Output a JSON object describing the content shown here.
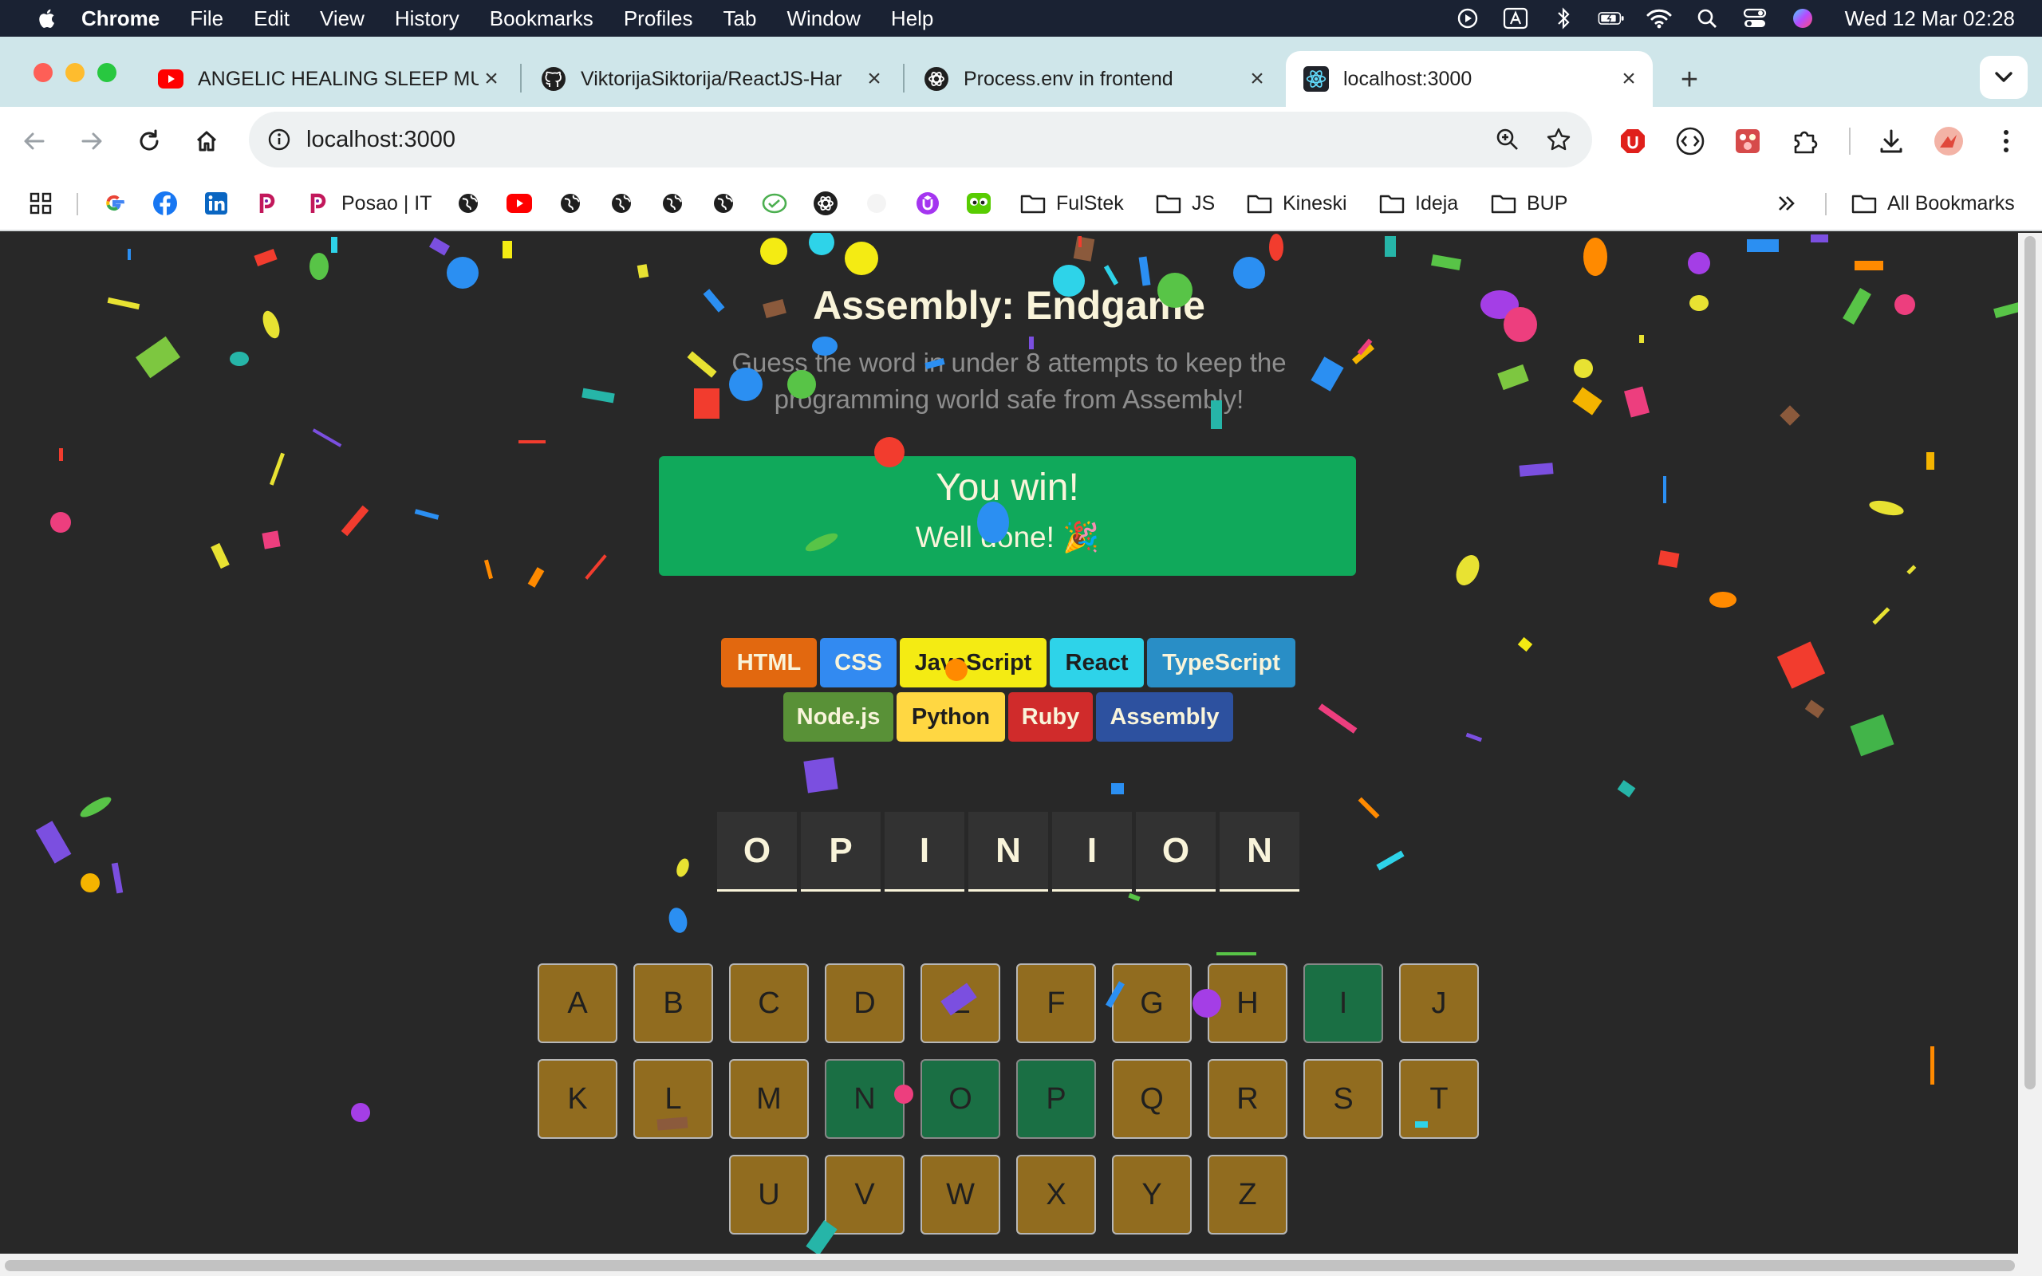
{
  "menubar": {
    "app_name": "Chrome",
    "items": [
      "File",
      "Edit",
      "View",
      "History",
      "Bookmarks",
      "Profiles",
      "Tab",
      "Window",
      "Help"
    ],
    "clock": "Wed 12 Mar  02:28"
  },
  "tabs": [
    {
      "title": "ANGELIC HEALING SLEEP MU",
      "icon": "youtube-icon"
    },
    {
      "title": "ViktorijaSiktorija/ReactJS-Har",
      "icon": "github-icon"
    },
    {
      "title": "Process.env in frontend",
      "icon": "chatgpt-icon"
    },
    {
      "title": "localhost:3000",
      "icon": "react-icon",
      "active": true
    }
  ],
  "omnibox": {
    "url": "localhost:3000"
  },
  "bookmarks": {
    "posao": "Posao | IT",
    "folders": [
      "FulStek",
      "JS",
      "Kineski",
      "Ideja",
      "BUP"
    ],
    "all": "All Bookmarks"
  },
  "game": {
    "title": "Assembly: Endgame",
    "subtitle": "Guess the word in under 8 attempts to keep the programming world safe from Assembly!",
    "status_title": "You win!",
    "status_sub": "Well done! 🎉",
    "languages": [
      {
        "name": "HTML",
        "bg": "#E2680F",
        "color": "#F9F4DA"
      },
      {
        "name": "CSS",
        "bg": "#328AF1",
        "color": "#F9F4DA"
      },
      {
        "name": "JavaScript",
        "bg": "#F4EB13",
        "color": "#1E1E1E"
      },
      {
        "name": "React",
        "bg": "#2ED3E9",
        "color": "#1E1E1E"
      },
      {
        "name": "TypeScript",
        "bg": "#298EC6",
        "color": "#F9F4DA"
      },
      {
        "name": "Node.js",
        "bg": "#599137",
        "color": "#F9F4DA"
      },
      {
        "name": "Python",
        "bg": "#FFD742",
        "color": "#1E1E1E"
      },
      {
        "name": "Ruby",
        "bg": "#D02B2B",
        "color": "#F9F4DA"
      },
      {
        "name": "Assembly",
        "bg": "#2D519F",
        "color": "#F9F4DA"
      }
    ],
    "word": [
      "O",
      "P",
      "I",
      "N",
      "I",
      "O",
      "N"
    ],
    "keyboard": {
      "row1": [
        "A",
        "B",
        "C",
        "D",
        "E",
        "F",
        "G",
        "H",
        "I",
        "J"
      ],
      "row2": [
        "K",
        "L",
        "M",
        "N",
        "O",
        "P",
        "Q",
        "R",
        "S",
        "T"
      ],
      "row3": [
        "U",
        "V",
        "W",
        "X",
        "Y",
        "Z"
      ],
      "correct_letters": [
        "I",
        "N",
        "O",
        "P"
      ]
    }
  },
  "colors": {
    "menubar_bg": "#1A2233",
    "tabstrip_bg": "#CFE6EA",
    "page_bg": "#282828",
    "status_win": "#10A95B",
    "key_wrong": "#A87C1E",
    "key_correct": "#10A95B"
  }
}
